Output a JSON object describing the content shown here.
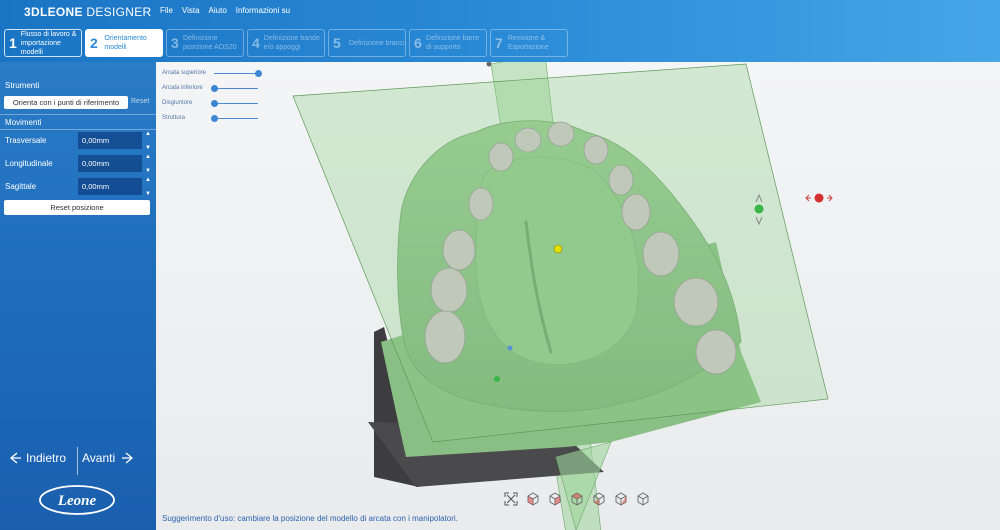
{
  "app": {
    "brand_bold": "3DLEONE",
    "brand_light": " DESIGNER"
  },
  "menu": [
    "File",
    "Vista",
    "Aiuto",
    "Informazioni su"
  ],
  "steps": [
    {
      "num": "1",
      "label": "Flusso di lavoro & importazione modelli",
      "state": "done"
    },
    {
      "num": "2",
      "label": "Orientamento modelli",
      "state": "active"
    },
    {
      "num": "3",
      "label": "Definizione posizione AOS20",
      "state": "pending"
    },
    {
      "num": "4",
      "label": "Definizione bande e/o appoggi",
      "state": "pending"
    },
    {
      "num": "5",
      "label": "Definizione bracci",
      "state": "pending"
    },
    {
      "num": "6",
      "label": "Definizione barre di supporto",
      "state": "pending"
    },
    {
      "num": "7",
      "label": "Revisione & Esportazione",
      "state": "pending"
    }
  ],
  "tools": {
    "title": "Strumenti",
    "orient_button": "Orienta con i punti di riferimento",
    "reset_link": "Reset"
  },
  "movements": {
    "title": "Movimenti",
    "rows": [
      {
        "label": "Trasversale",
        "value": "0,00mm"
      },
      {
        "label": "Longitudinale",
        "value": "0,00mm"
      },
      {
        "label": "Sagittale",
        "value": "0,00mm"
      }
    ],
    "reset_button": "Reset posizione"
  },
  "nav": {
    "back": "Indietro",
    "forward": "Avanti"
  },
  "logo_text": "Leone",
  "sliders": [
    {
      "label": "Arcata superiore",
      "level": 1.0
    },
    {
      "label": "Arcata inferiore",
      "level": 0.0
    },
    {
      "label": "Disgiuntore",
      "level": 0.0
    },
    {
      "label": "Struttura",
      "level": 0.0
    }
  ],
  "hint": "Suggerimento d'uso: cambiare la posizione del modello di arcata con i manipolatori.",
  "icons": {
    "back": "arrow-left-icon",
    "forward": "arrow-right-icon",
    "fit": "fit-view-icon",
    "views": "cube-view-icon"
  },
  "colors": {
    "brand_blue": "#1a74c4",
    "panel_blue": "#1f6fbf",
    "model_green": "#8cc08a",
    "plane_green": "#9fd69b"
  }
}
